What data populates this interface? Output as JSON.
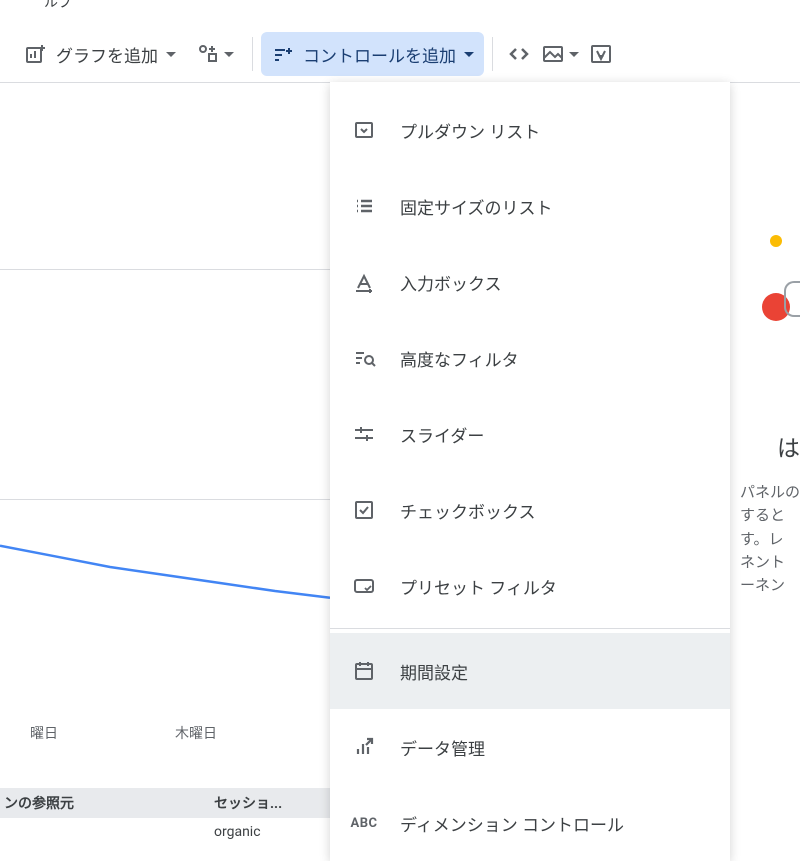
{
  "frag_top": "ルプ",
  "toolbar": {
    "add_chart_label": "グラフを追加",
    "add_control_label": "コントロールを追加"
  },
  "menu": {
    "items": [
      {
        "label": "プルダウン リスト",
        "icon": "dropdown-list-icon"
      },
      {
        "label": "固定サイズのリスト",
        "icon": "fixed-list-icon"
      },
      {
        "label": "入力ボックス",
        "icon": "input-box-icon"
      },
      {
        "label": "高度なフィルタ",
        "icon": "advanced-filter-icon"
      },
      {
        "label": "スライダー",
        "icon": "slider-icon"
      },
      {
        "label": "チェックボックス",
        "icon": "checkbox-icon"
      },
      {
        "label": "プリセット フィルタ",
        "icon": "preset-filter-icon"
      }
    ],
    "section2": [
      {
        "label": "期間設定",
        "icon": "date-range-icon",
        "hovered": true
      },
      {
        "label": "データ管理",
        "icon": "data-control-icon"
      },
      {
        "label": "ディメンション コントロール",
        "icon": "dimension-control-icon"
      }
    ]
  },
  "chart_data": {
    "type": "line",
    "categories": [
      "曜日",
      "木曜日"
    ],
    "x_positions": [
      40,
      188
    ],
    "values": [
      118,
      110,
      102,
      96,
      90,
      84,
      79
    ],
    "ylim": [
      0,
      150
    ],
    "title": "",
    "xlabel": "",
    "ylabel": ""
  },
  "table": {
    "headers": [
      "ンの参照元",
      "セッショ..."
    ],
    "rows": [
      [
        "",
        "organic"
      ]
    ]
  },
  "right_panel": {
    "heading": "は",
    "lines": [
      "パネルの",
      "すると",
      "す。レ",
      "ネント",
      "ーネン"
    ]
  }
}
